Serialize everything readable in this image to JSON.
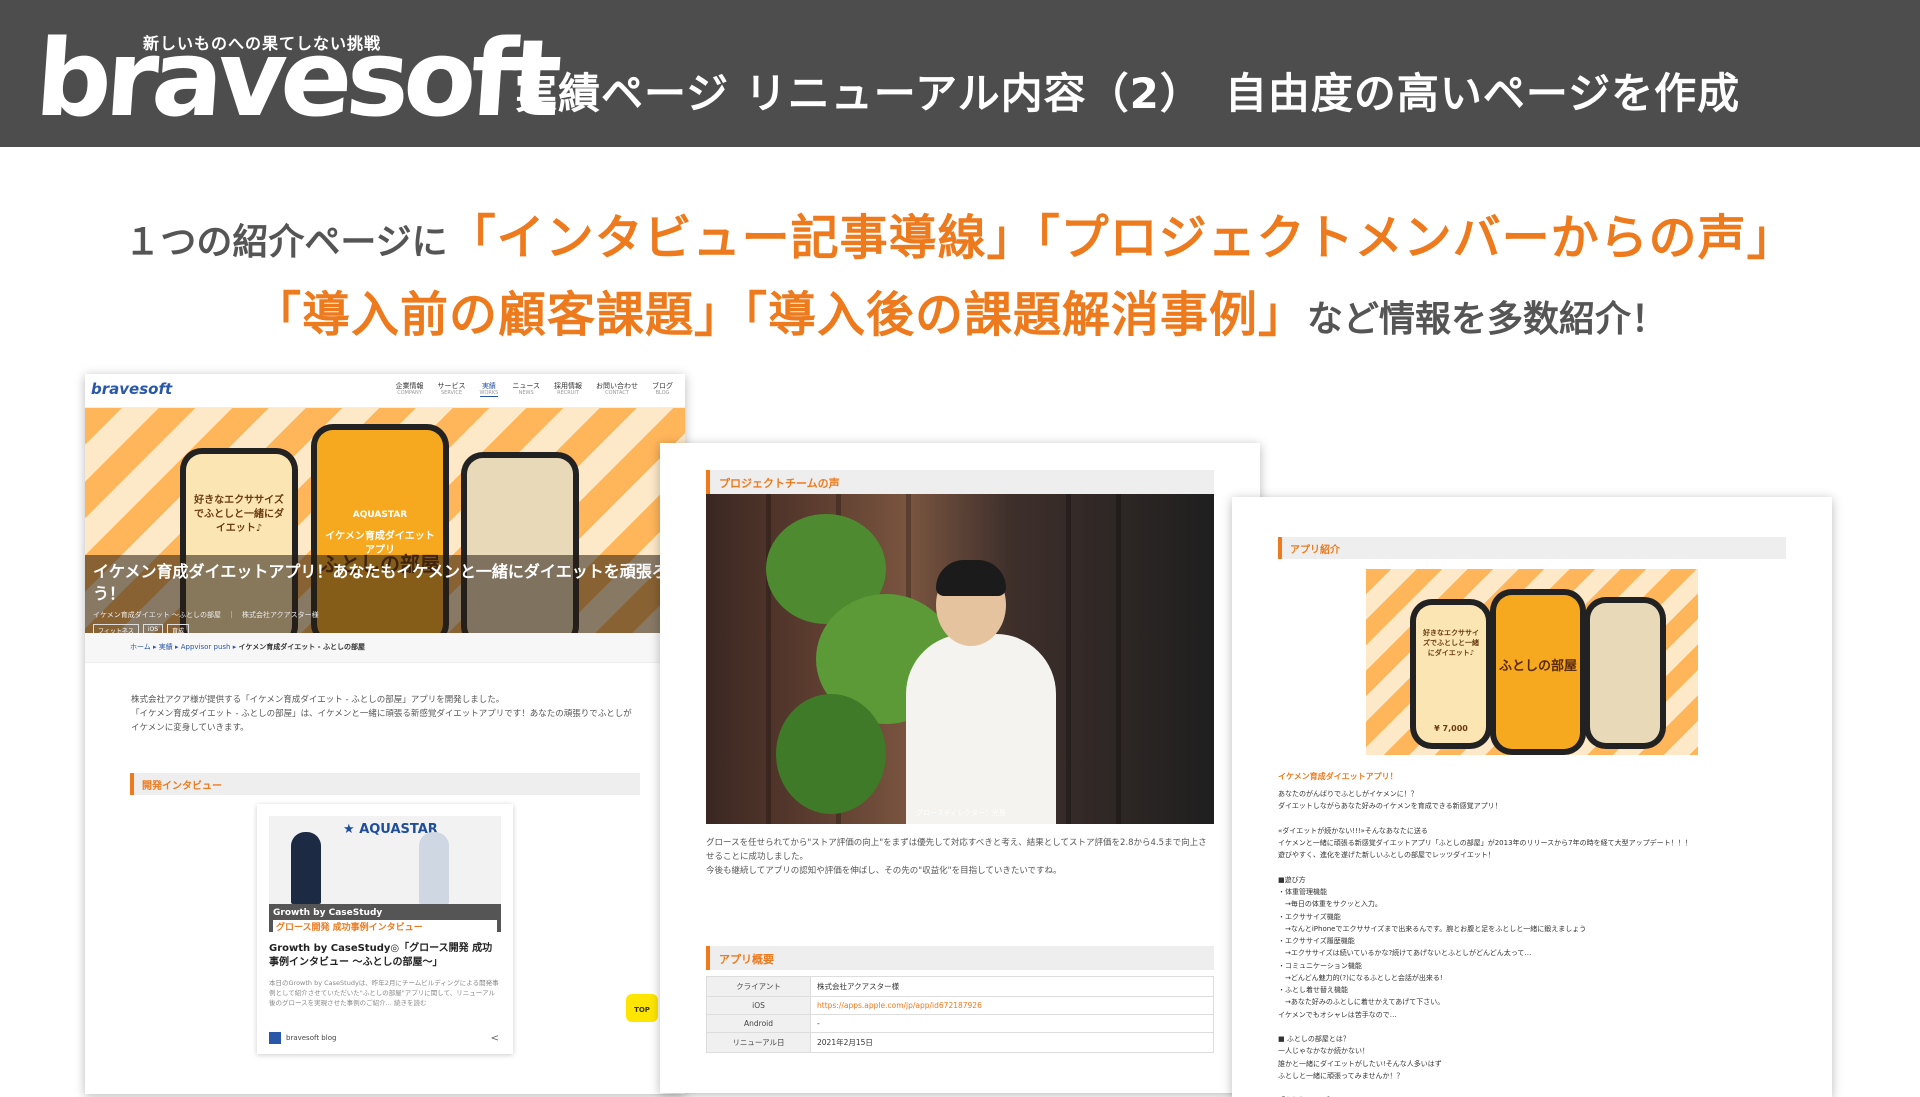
{
  "header": {
    "tagline": "新しいものへの果てしない挑戦",
    "logo": "bravesoft",
    "title": "実績ページ リニューアル内容（2）　自由度の高いページを作成"
  },
  "headline": {
    "p1": "１つの紹介ページに",
    "o1": "「インタビュー記事導線」「プロジェクトメンバーからの声」",
    "o2": "「導入前の顧客課題」「導入後の課題解消事例」",
    "p2": "など情報を多数紹介！"
  },
  "card1": {
    "nav_logo": "bravesoft",
    "nav": [
      {
        "label": "企業情報",
        "sub": "COMPANY"
      },
      {
        "label": "サービス",
        "sub": "SERVICE"
      },
      {
        "label": "実績",
        "sub": "WORKS"
      },
      {
        "label": "ニュース",
        "sub": "NEWS"
      },
      {
        "label": "採用情報",
        "sub": "RECRUIT"
      },
      {
        "label": "お問い合わせ",
        "sub": "CONTACT"
      },
      {
        "label": "ブログ",
        "sub": "BLOG"
      }
    ],
    "phone1_text": "好きなエクササイズでふとしと一緒にダイエット♪",
    "phone2_brand": "AQUASTAR",
    "phone2_text": "イケメン育成ダイエットアプリ",
    "phone2_big": "ふとしの部屋",
    "hero_title": "イケメン育成ダイエットアプリ！あなたもイケメンと一緒にダイエットを頑張ろう！",
    "hero_sub": "イケメン育成ダイエット ～ふとしの部屋　｜　株式会社アクアスター様",
    "chips": [
      "フィットネス",
      "iOS",
      "育成"
    ],
    "crumb": [
      "ホーム",
      "実績",
      "Appvisor push"
    ],
    "crumb_current": "イケメン育成ダイエット - ふとしの部屋",
    "body": "株式会社アクア様が提供する「イケメン育成ダイエット - ふとしの部屋」アプリを開発しました。\n「イケメン育成ダイエット - ふとしの部屋」は、イケメンと一緒に頑張る新感覚ダイエットアプリです！あなたの頑張りでふとしがイケメンに変身していきます。",
    "section": "開発インタビュー",
    "blog_brand": "AQUASTAR",
    "blog_band": "Growth by CaseStudy",
    "blog_band_sub": "グロース開発 成功事例インタビュー",
    "blog_title": "Growth by CaseStudy◎「グロース開発 成功事例インタビュー ～ふとしの部屋～」",
    "blog_desc": "本日のGrowth by CaseStudyは、昨年2月にチームビルディングによる開発事例として紹介させていただいた\"ふとしの部屋\"アプリに関して、リニューアル後のグロースを実現させた事例のご紹介... 続きを読む",
    "blog_foot": "bravesoft blog",
    "top": "TOP"
  },
  "card2": {
    "section": "プロジェクトチームの声",
    "photo_caption": "グロースディレクター：光島",
    "text": "グロースを任せられてから\"ストア評価の向上\"をまずは優先して対応すべきと考え、結果としてストア評価を2.8から4.5まで向上させることに成功しました。\n今後も継続してアプリの認知や評価を伸ばし、その先の\"収益化\"を目指していきたいですね。",
    "section2": "アプリ概要",
    "table": [
      {
        "k": "クライアント",
        "v": "株式会社アクアスター様"
      },
      {
        "k": "iOS",
        "v": "https://apps.apple.com/jp/app/id672187926"
      },
      {
        "k": "Android",
        "v": "-"
      },
      {
        "k": "リニューアル日",
        "v": "2021年2月15日"
      }
    ]
  },
  "card3": {
    "section": "アプリ紹介",
    "banner_text": "好きなエクササイズでふとしと一緒にダイエット♪",
    "banner_big": "ふとしの部屋",
    "banner_price": "7,000",
    "intro_head": "イケメン育成ダイエットアプリ！",
    "intro": "あなたのがんばりでふとしがイケメンに！？\nダイエットしながらあなた好みのイケメンを育成できる新感覚アプリ！\n\n«ダイエットが続かない!!!»そんなあなたに送る\nイケメンと一緒に頑張る新感覚ダイエットアプリ「ふとしの部屋」が2013年のリリースから7年の時を経て大型アップデート！！！\n遊びやすく、進化を遂げた新しいふとしの部屋でレッツダイエット！\n\n■遊び方\n・体重管理機能\n　→毎日の体重をサクッと入力。\n・エクササイズ機能\n　→なんとiPhoneでエクササイズまで出来るんです。腕とお腹と足をふとしと一緒に鍛えましょう\n・エクササイズ履歴機能\n　→エクササイズは続いているかな?続けてあげないとふとしがどんどん太って…\n・コミュニケーション機能\n　→どんどん魅力的(?)になるふとしと会話が出来る!\n・ふとし着せ替え機能\n　→あなた好みのふとしに着せかえてあげて下さい。\nイケメンでもオシャレは苦手なので…\n\n■ ふとしの部屋とは？\n一人じゃなかなか続かない！\n誰かと一緒にダイエットがしたい!そんな人多いはず\nふとしと一緒に頑張ってみませんか！？\n\n「ふとし」って？\n・太っています"
  }
}
